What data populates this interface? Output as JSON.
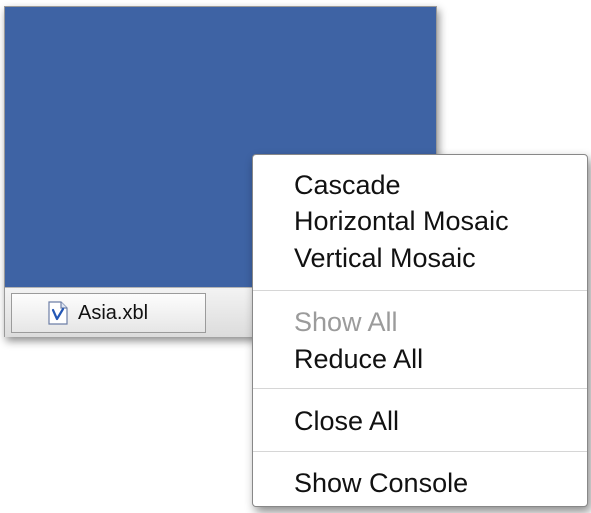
{
  "taskbar": {
    "items": [
      {
        "label": "Asia.xbl",
        "icon": "xbl-file-icon"
      }
    ]
  },
  "context_menu": {
    "groups": [
      {
        "items": [
          {
            "label": "Cascade",
            "enabled": true
          },
          {
            "label": "Horizontal Mosaic",
            "enabled": true
          },
          {
            "label": "Vertical Mosaic",
            "enabled": true
          }
        ]
      },
      {
        "items": [
          {
            "label": "Show All",
            "enabled": false
          },
          {
            "label": "Reduce All",
            "enabled": true
          }
        ]
      },
      {
        "items": [
          {
            "label": "Close All",
            "enabled": true
          }
        ]
      },
      {
        "items": [
          {
            "label": "Show Console",
            "enabled": true
          }
        ]
      }
    ]
  },
  "colors": {
    "mdi_background": "#3e63a4",
    "disabled_text": "#9b9b9b"
  }
}
